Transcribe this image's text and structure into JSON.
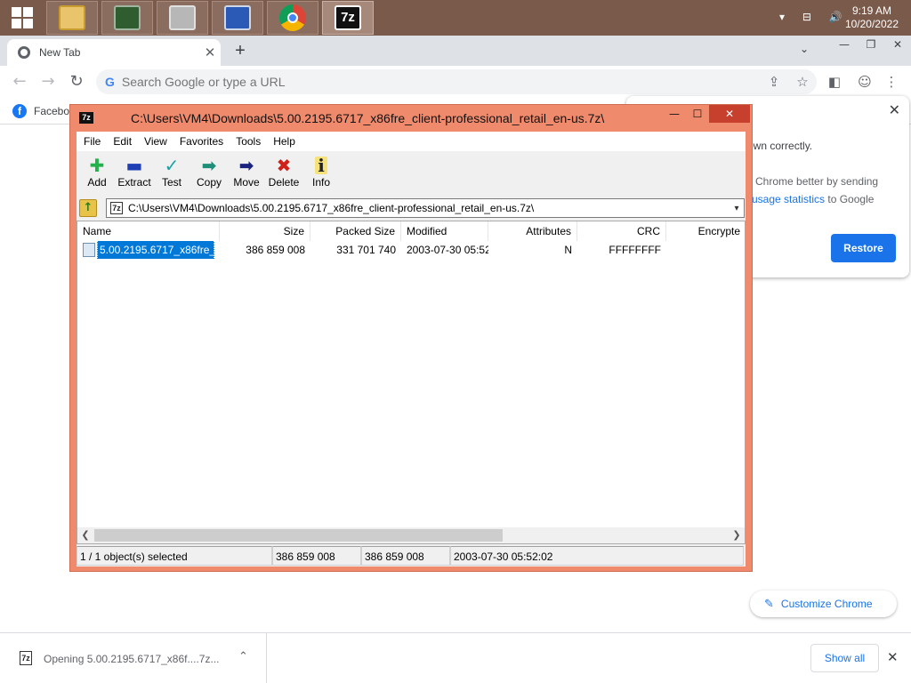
{
  "taskbar": {
    "clock_time": "9:19 AM",
    "clock_date": "10/20/2022",
    "tray_icons": "▾ ⊟ 🔊",
    "colors": {
      "bg": "#7a5a4b"
    },
    "apps": [
      {
        "icon": "file-explorer-icon"
      },
      {
        "icon": "terminal-icon"
      },
      {
        "icon": "printer-icon"
      },
      {
        "icon": "system-info-icon"
      },
      {
        "icon": "chrome-icon"
      },
      {
        "icon": "7zip-icon",
        "label": "7z"
      }
    ]
  },
  "chrome": {
    "tab_title": "New Tab",
    "tab_close": "✕",
    "new_tab": "+",
    "tab_search": "⌄",
    "window_controls": {
      "minimize": "—",
      "maximize": "❐",
      "close": "✕"
    },
    "nav": {
      "back": "←",
      "forward": "→",
      "reload": "↻"
    },
    "omnibox": {
      "placeholder": "Search Google or type a URL",
      "g": "G",
      "share": "⇪",
      "star": "☆"
    },
    "toolbar": {
      "sidepanel": "◧",
      "profile": "☺",
      "menu": "⋮"
    },
    "bookmark": {
      "label": "Faceboo",
      "icon": "f"
    },
    "restore_bubble": {
      "line1": "own correctly.",
      "line2": "Chrome better by sending",
      "line3_link": "usage statistics",
      "line3_rest": " to Google",
      "close": "✕",
      "button": "Restore"
    },
    "customize": {
      "label": "Customize Chrome",
      "pen": "✎"
    },
    "download": {
      "text": "Opening 5.00.2195.6717_x86f....7z...",
      "chevron": "⌃",
      "show_all": "Show all",
      "close": "✕"
    },
    "colors": {
      "accent": "#1a73e8"
    }
  },
  "zip": {
    "title": "C:\\Users\\VM4\\Downloads\\5.00.2195.6717_x86fre_client-professional_retail_en-us.7z\\",
    "app_icon": "7z",
    "controls": {
      "minimize": "—",
      "maximize": "☐",
      "close": "✕"
    },
    "menu": [
      "File",
      "Edit",
      "View",
      "Favorites",
      "Tools",
      "Help"
    ],
    "tools": [
      {
        "label": "Add",
        "glyph": "✚",
        "color": "#22b14c",
        "icon": "add-icon"
      },
      {
        "label": "Extract",
        "glyph": "▬",
        "color": "#1f3fb5",
        "icon": "extract-icon"
      },
      {
        "label": "Test",
        "glyph": "✓",
        "color": "#1aa3a3",
        "icon": "test-icon"
      },
      {
        "label": "Copy",
        "glyph": "➡",
        "color": "#1f8f7a",
        "icon": "copy-icon"
      },
      {
        "label": "Move",
        "glyph": "➡",
        "color": "#1a237e",
        "icon": "move-icon"
      },
      {
        "label": "Delete",
        "glyph": "✖",
        "color": "#d0201a",
        "icon": "delete-icon"
      },
      {
        "label": "Info",
        "glyph": "i",
        "color": "#222222",
        "icon": "info-icon"
      }
    ],
    "path": "C:\\Users\\VM4\\Downloads\\5.00.2195.6717_x86fre_client-professional_retail_en-us.7z\\",
    "columns": {
      "name": "Name",
      "size": "Size",
      "packed": "Packed Size",
      "modified": "Modified",
      "attributes": "Attributes",
      "crc": "CRC",
      "encrypted": "Encrypte"
    },
    "rows": [
      {
        "name": "5.00.2195.6717_x86fre_cl...",
        "size": "386 859 008",
        "packed": "331 701 740",
        "modified": "2003-07-30 05:52",
        "attributes": "N",
        "crc": "FFFFFFFF"
      }
    ],
    "status": {
      "selected": "1 / 1 object(s) selected",
      "size": "386 859 008",
      "packed": "386 859 008",
      "modified": "2003-07-30 05:52:02"
    },
    "scroll": {
      "left": "❮",
      "right": "❯"
    },
    "colors": {
      "frame": "#f08a6c",
      "selection": "#0078d7"
    }
  }
}
